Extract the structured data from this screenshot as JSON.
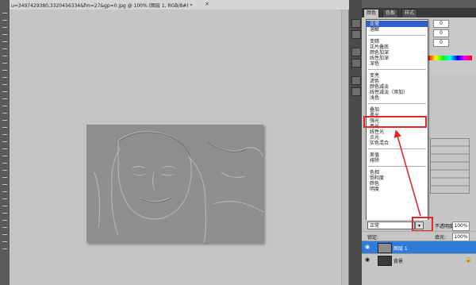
{
  "document": {
    "tab_title": "u=3497429380,3320456334&fm=27&gp=0.jpg @ 100% (图层 1, RGB/8#) *",
    "close_glyph": "×"
  },
  "panel_tabs": [
    "颜色",
    "色板",
    "样式"
  ],
  "color_values": [
    "0",
    "0",
    "0"
  ],
  "blend_modes": {
    "groups": [
      [
        "正常",
        "溶解"
      ],
      [
        "变暗",
        "正片叠底",
        "颜色加深",
        "线性加深",
        "深色"
      ],
      [
        "变亮",
        "滤色",
        "颜色减淡",
        "线性减淡（添加）",
        "浅色"
      ],
      [
        "叠加",
        "柔光",
        "强光",
        "亮光",
        "线性光",
        "点光",
        "实色混合"
      ],
      [
        "差值",
        "排除"
      ],
      [
        "色相",
        "饱和度",
        "颜色",
        "明度"
      ]
    ],
    "selected": "正常",
    "highlighted": "叠加"
  },
  "layers_panel": {
    "blend_value": "正常",
    "opacity_label": "不透明度:",
    "opacity_value": "100%",
    "lock_label": "锁定:",
    "fill_label": "填充:",
    "fill_value": "100%",
    "layers": [
      {
        "name": "图层 1",
        "selected": true
      },
      {
        "name": "背景",
        "selected": false
      }
    ]
  },
  "colors": {
    "highlight": "#e02828",
    "selection": "#2e7bd8"
  }
}
